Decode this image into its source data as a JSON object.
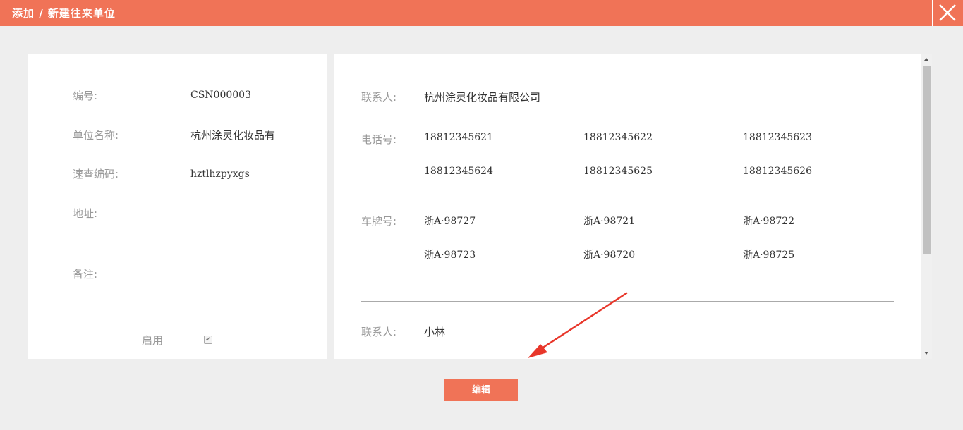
{
  "header": {
    "title": "添加 / 新建往来单位",
    "close_icon": "close-icon"
  },
  "left_form": {
    "code_label": "编号:",
    "code_value": "CSN000003",
    "name_label": "单位名称:",
    "name_value": "杭州涂灵化妆品有",
    "quick_code_label": "速查编码:",
    "quick_code_value": "hztlhzpyxgs",
    "address_label": "地址:",
    "remark_label": "备注:",
    "enabled_label": "启用",
    "enabled_checked": true
  },
  "contacts": [
    {
      "contact_label": "联系人:",
      "contact_value": "杭州涂灵化妆品有限公司",
      "phone_label": "电话号:",
      "phones": [
        "18812345621",
        "18812345622",
        "18812345623",
        "18812345624",
        "18812345625",
        "18812345626"
      ],
      "plate_label": "车牌号:",
      "plates": [
        "浙A·98727",
        "浙A·98721",
        "浙A·98722",
        "浙A·98723",
        "浙A·98720",
        "浙A·98725"
      ]
    },
    {
      "contact_label": "联系人:",
      "contact_value": "小林"
    }
  ],
  "footer": {
    "edit_label": "编辑"
  },
  "colors": {
    "accent": "#f07357",
    "background": "#eeeeee",
    "label": "#999999",
    "arrow": "#e8362a"
  }
}
